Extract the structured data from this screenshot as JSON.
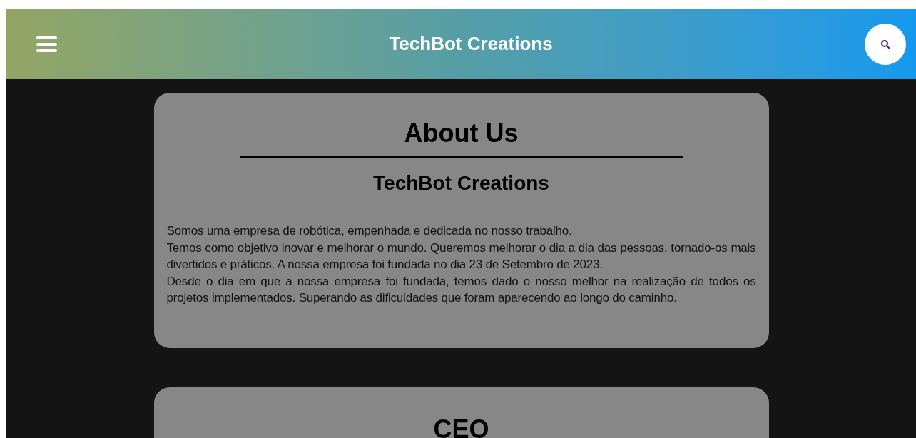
{
  "header": {
    "title": "TechBot Creations"
  },
  "about": {
    "heading": "About Us",
    "subheading": "TechBot Creations",
    "paragraphs": [
      "Somos uma empresa de robótica, empenhada e dedicada no nosso trabalho.",
      "Temos como objetivo inovar e melhorar o mundo. Queremos melhorar o dia a dia das pessoas, tornado-os mais divertidos e práticos. A nossa empresa foi fundada no dia 23 de Setembro de 2023.",
      "Desde o dia em que a nossa empresa foi fundada, temos dado o nosso melhor na realização de todos os projetos implementados. Superando as dificuldades que foram aparecendo ao longo do caminho."
    ]
  },
  "ceo": {
    "heading": "CEO"
  }
}
